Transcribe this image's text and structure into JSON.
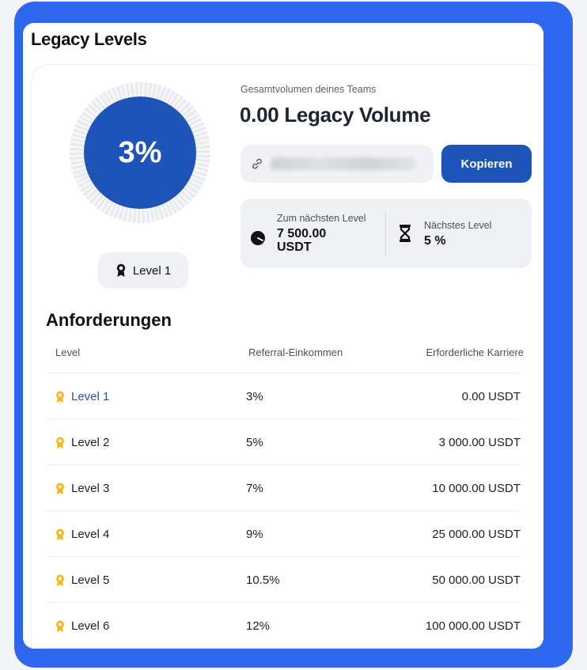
{
  "title": "Legacy Levels",
  "progress": {
    "percent_label": "3%",
    "current_level": "Level 1"
  },
  "team": {
    "label": "Gesamtvolumen deines Teams",
    "volume": "0.00 Legacy Volume"
  },
  "referral": {
    "copy_label": "Kopieren"
  },
  "stats": {
    "next_level_label": "Zum nächsten Level",
    "next_level_amount": "7 500.00",
    "next_level_unit": "USDT",
    "next_level_percent_label": "Nächstes Level",
    "next_level_percent": "5 %"
  },
  "requirements": {
    "title": "Anforderungen",
    "columns": [
      "Level",
      "Referral-Einkommen",
      "Erforderliche Karriere"
    ],
    "rows": [
      {
        "level": "Level 1",
        "income": "3%",
        "career": "0.00 USDT"
      },
      {
        "level": "Level 2",
        "income": "5%",
        "career": "3 000.00 USDT"
      },
      {
        "level": "Level 3",
        "income": "7%",
        "career": "10 000.00 USDT"
      },
      {
        "level": "Level 4",
        "income": "9%",
        "career": "25 000.00 USDT"
      },
      {
        "level": "Level 5",
        "income": "10.5%",
        "career": "50 000.00 USDT"
      },
      {
        "level": "Level 6",
        "income": "12%",
        "career": "100 000.00 USDT"
      }
    ]
  },
  "colors": {
    "frame": "#2e66f0",
    "primary": "#1e54b8",
    "medal": "#f2b824"
  },
  "icons": [
    "award-icon",
    "link-icon",
    "clock-icon",
    "hourglass-icon",
    "medal-icon"
  ]
}
